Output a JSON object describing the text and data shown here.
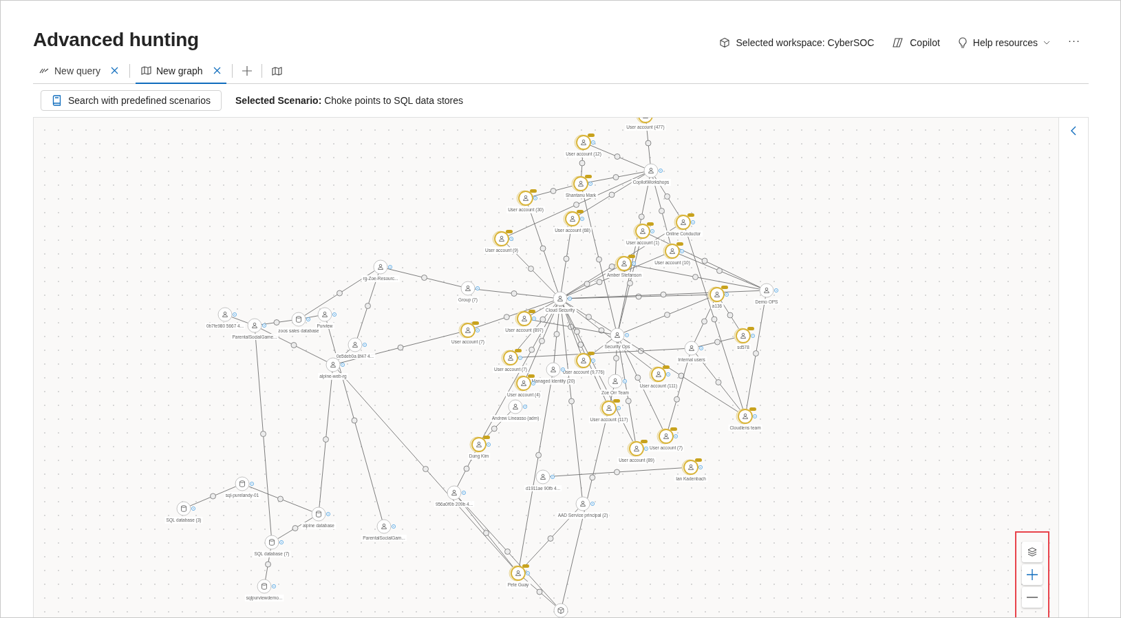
{
  "header": {
    "title": "Advanced hunting",
    "workspace": "Selected workspace: CyberSOC",
    "copilot": "Copilot",
    "help": "Help resources",
    "more": "···"
  },
  "tabs": [
    {
      "label": "New query",
      "kind": "query",
      "selected": false
    },
    {
      "label": "New graph",
      "kind": "graph",
      "selected": true
    }
  ],
  "toolbar": {
    "scenario_button": "Search with predefined scenarios",
    "scenario_text": "**Selected Scenario:** Choke points to SQL data stores"
  },
  "graph": {
    "nodes": [
      {
        "label": "User account (477)",
        "kind": "user",
        "critical": true
      },
      {
        "label": "User account (12)",
        "kind": "user",
        "critical": true
      },
      {
        "label": "CopilotWorkshops",
        "kind": "user",
        "critical": false
      },
      {
        "label": "Shantanu Mark",
        "kind": "user",
        "critical": true
      },
      {
        "label": "User account (30)",
        "kind": "user",
        "critical": true
      },
      {
        "label": "User account (68)",
        "kind": "user",
        "critical": true
      },
      {
        "label": "User account (9)",
        "kind": "user",
        "critical": true
      },
      {
        "label": "User account (1)",
        "kind": "user",
        "critical": true
      },
      {
        "label": "Online Conductor",
        "kind": "user",
        "critical": true
      },
      {
        "label": "User account (10)",
        "kind": "user",
        "critical": true
      },
      {
        "label": "Amber Stefanson",
        "kind": "user",
        "critical": true
      },
      {
        "label": "rg-Zoe-Resourc...",
        "kind": "user",
        "critical": false
      },
      {
        "label": "Group (7)",
        "kind": "user",
        "critical": false
      },
      {
        "label": "Cloud Security",
        "kind": "user",
        "critical": false
      },
      {
        "label": "a136",
        "kind": "user",
        "critical": true
      },
      {
        "label": "Demo OPS",
        "kind": "user",
        "critical": false
      },
      {
        "label": "0b7fe980 5667 4...",
        "kind": "user",
        "critical": false
      },
      {
        "label": "ParentalSocialGame...",
        "kind": "user",
        "critical": false
      },
      {
        "label": "Purview",
        "kind": "user",
        "critical": false
      },
      {
        "label": "zoos sales database",
        "kind": "database",
        "critical": false
      },
      {
        "label": "User account (897)",
        "kind": "user",
        "critical": true
      },
      {
        "label": "User account (7)",
        "kind": "user",
        "critical": true
      },
      {
        "label": "Security Ops",
        "kind": "user",
        "critical": false
      },
      {
        "label": "sd578",
        "kind": "user",
        "critical": true
      },
      {
        "label": "0e5deb0a 8f47 4...",
        "kind": "user",
        "critical": false
      },
      {
        "label": "Internal users",
        "kind": "user",
        "critical": false
      },
      {
        "label": "User account (7)",
        "kind": "user",
        "critical": true
      },
      {
        "label": "User account (9,776)",
        "kind": "user",
        "critical": true
      },
      {
        "label": "alpine-web-rg",
        "kind": "user",
        "critical": false
      },
      {
        "label": "Managed identity (20)",
        "kind": "user",
        "critical": false
      },
      {
        "label": "User account (111)",
        "kind": "user",
        "critical": true
      },
      {
        "label": "User account (4)",
        "kind": "user",
        "critical": true
      },
      {
        "label": "Zoe Orr Team",
        "kind": "user",
        "critical": false
      },
      {
        "label": "Andrew Lineasso (adm)",
        "kind": "user",
        "critical": false
      },
      {
        "label": "User account (117)",
        "kind": "user",
        "critical": true
      },
      {
        "label": "Cloudlens team",
        "kind": "user",
        "critical": true
      },
      {
        "label": "Dung Kim",
        "kind": "user",
        "critical": true
      },
      {
        "label": "User account (7)",
        "kind": "user",
        "critical": true
      },
      {
        "label": "User account (89)",
        "kind": "user",
        "critical": true
      },
      {
        "label": "Ian Kadenbach",
        "kind": "user",
        "critical": true
      },
      {
        "label": "d1911ae 90fb 4...",
        "kind": "user",
        "critical": false
      },
      {
        "label": "sql-purelandy-01",
        "kind": "database",
        "critical": false
      },
      {
        "label": "956a0f0b 209b 4...",
        "kind": "user",
        "critical": false
      },
      {
        "label": "AAD Service principal (2)",
        "kind": "user",
        "critical": false
      },
      {
        "label": "SQL database (3)",
        "kind": "database",
        "critical": false
      },
      {
        "label": "alpine database",
        "kind": "database",
        "critical": false
      },
      {
        "label": "ParentalSocialGam...",
        "kind": "user",
        "critical": false
      },
      {
        "label": "SQL database (7)",
        "kind": "database",
        "critical": false
      },
      {
        "label": "Pete Guay",
        "kind": "user",
        "critical": true
      },
      {
        "label": "sqlpurviewdemo...",
        "kind": "database",
        "critical": false
      },
      {
        "kind": "resource",
        "critical": false
      }
    ]
  }
}
